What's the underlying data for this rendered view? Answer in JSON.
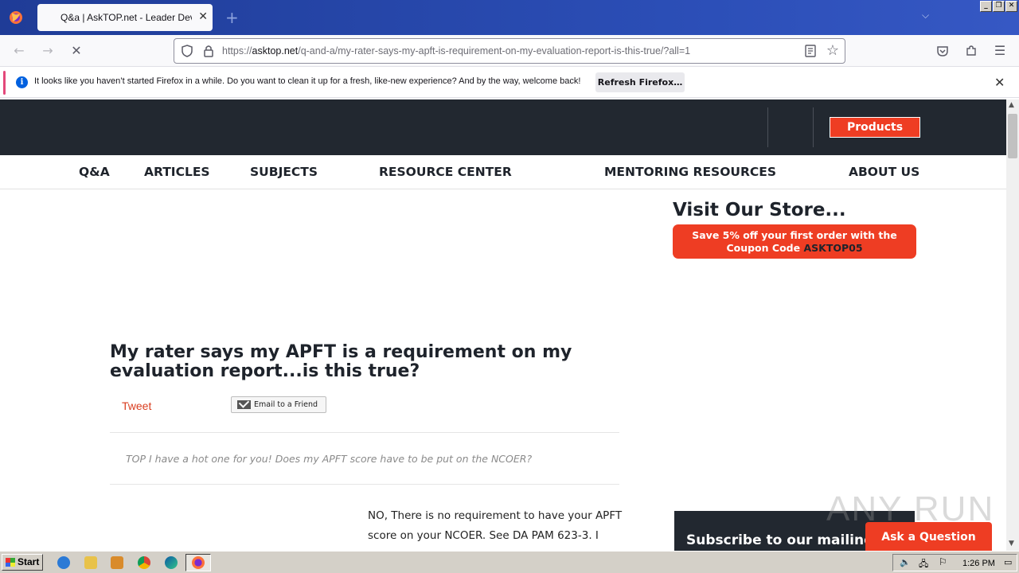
{
  "browser": {
    "tab_title": "Q&a | AskTOP.net - Leader Development",
    "url_prefix": "https://",
    "url_domain": "asktop.net",
    "url_path": "/q-and-a/my-rater-says-my-apft-is-requirement-on-my-evaluation-report-is-this-true/?all=1",
    "notification_text": "It looks like you haven’t started Firefox in a while. Do you want to clean it up for a fresh, like-new experience? And by the way, welcome back!",
    "notification_button": "Refresh Firefox…"
  },
  "site": {
    "products_label": "Products",
    "nav": [
      "Q&A",
      "ARTICLES",
      "SUBJECTS",
      "RESOURCE CENTER",
      "MENTORING RESOURCES",
      "ABOUT US"
    ],
    "store_title": "Visit Our Store...",
    "coupon_line1": "Save 5% off your first order with the",
    "coupon_line2_prefix": "Coupon Code ",
    "coupon_code": "ASKTOP05",
    "question_title": "My rater says my APFT is a requirement on my evaluation report...is this true?",
    "tweet_label": "Tweet",
    "email_label": "Email to a Friend",
    "question_text": "TOP I have a hot one for you! Does my APFT score have to be put on the NCOER?",
    "answer_text": "NO, There is no requirement to have your APFT score on your NCOER.  See DA PAM 623-3.  I have looked at the regs and ideas. These have",
    "subscribe_text": "Subscribe to our mailing list",
    "ask_button": "Ask a Question"
  },
  "watermark": "ANY RUN",
  "taskbar": {
    "start_label": "Start",
    "clock": "1:26 PM"
  }
}
